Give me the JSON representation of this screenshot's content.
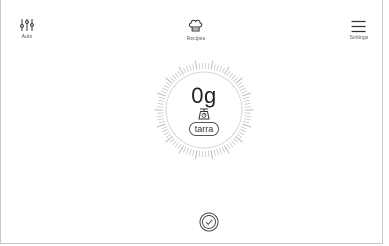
{
  "header": {
    "auto": {
      "label": "Auto",
      "icon": "sliders-icon"
    },
    "recipes": {
      "label": "Recipes",
      "icon": "chef-hat-icon"
    },
    "settings": {
      "label": "Settings",
      "icon": "menu-icon"
    }
  },
  "scale": {
    "weight": "0g",
    "icon": "kitchen-scale-icon",
    "tare_label": "tarra"
  },
  "footer": {
    "confirm_icon": "check-circle-icon"
  }
}
